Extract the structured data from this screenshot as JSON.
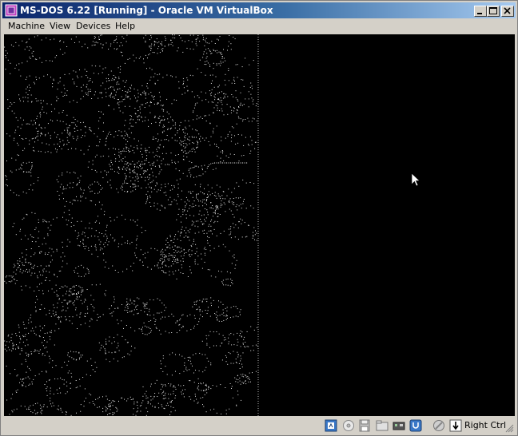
{
  "window": {
    "title": "MS-DOS 6.22 [Running] - Oracle VM VirtualBox"
  },
  "menu": {
    "items": [
      "Machine",
      "View",
      "Devices",
      "Help"
    ]
  },
  "statusbar": {
    "host_key_label": "Right Ctrl",
    "icons": [
      "hard-disk-icon",
      "optical-drive-icon",
      "floppy-icon",
      "shared-folders-icon",
      "network-icon",
      "usb-icon",
      "virtualization-icon",
      "mouse-integration-icon"
    ]
  },
  "colors": {
    "titlebar_start": "#0a246a",
    "titlebar_end": "#a6caf0",
    "screen": "#000000",
    "chrome": "#d4d0c8"
  }
}
